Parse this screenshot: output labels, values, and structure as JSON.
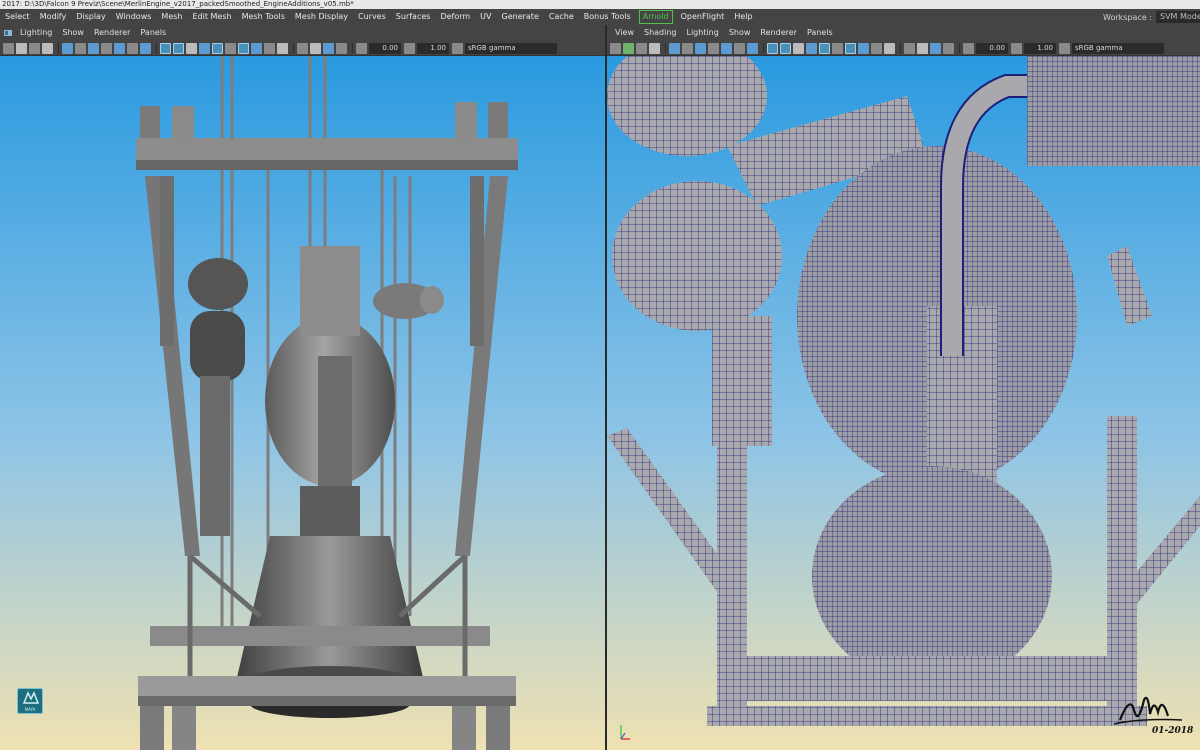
{
  "window": {
    "title": "2017: D:\\3D\\Falcon 9 Previz\\Scene\\MerlinEngine_v2017_packedSmoothed_EngineAdditions_v05.mb*"
  },
  "menubar": {
    "items": [
      "Select",
      "Modify",
      "Display",
      "Windows",
      "Mesh",
      "Edit Mesh",
      "Mesh Tools",
      "Mesh Display",
      "Curves",
      "Surfaces",
      "Deform",
      "UV",
      "Generate",
      "Cache",
      "Bonus Tools",
      "Arnold",
      "OpenFlight",
      "Help"
    ],
    "workspace_label": "Workspace :",
    "workspace_value": "SVM Mode"
  },
  "left_panel": {
    "menu": [
      "Lighting",
      "Show",
      "Renderer",
      "Panels"
    ],
    "toolbar": {
      "value_a": "0.00",
      "value_b": "1.00",
      "color_space": "sRGB gamma"
    }
  },
  "right_panel": {
    "menu": [
      "View",
      "Shading",
      "Lighting",
      "Show",
      "Renderer",
      "Panels"
    ],
    "toolbar": {
      "value_a": "0.00",
      "value_b": "1.00",
      "color_space": "sRGB gamma"
    }
  },
  "watermark": {
    "logo_label": "MAYA",
    "signature_initials": "SMM",
    "signature_date": "01-2018"
  },
  "colors": {
    "ui_background": "#444444",
    "viewport_sky_top": "#2a9ae0",
    "viewport_sky_bottom": "#efe1b2",
    "arnold_accent": "#4fc24a",
    "wireframe": "#1b1f7a",
    "shaded_model": "#8e8e8e"
  }
}
